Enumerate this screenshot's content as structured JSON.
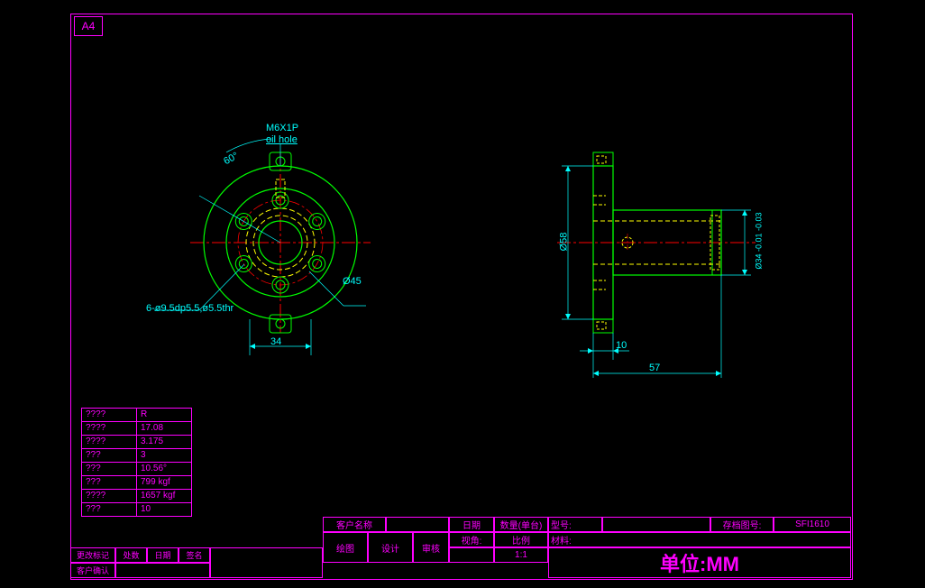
{
  "paper": "A4",
  "annotations": {
    "thread": "M6X1P",
    "oil_hole": "oil hole",
    "angle": "60°",
    "diameter45": "Ø45",
    "hole_spec": "6-ø9.5dp5.5,ø5.5thr",
    "dim34": "34",
    "dim58": "Ø58",
    "dim34_tol": "Ø34 -0.01 -0.03",
    "dim10": "10",
    "dim57": "57"
  },
  "spec_table": [
    {
      "k": "????",
      "v": "R"
    },
    {
      "k": "????",
      "v": "17.08"
    },
    {
      "k": "????",
      "v": "3.175"
    },
    {
      "k": "???",
      "v": "3"
    },
    {
      "k": "???",
      "v": "10.56°"
    },
    {
      "k": "???",
      "v": "799 kgf"
    },
    {
      "k": "????",
      "v": "1657 kgf"
    },
    {
      "k": "???",
      "v": "10"
    }
  ],
  "title_block": {
    "customer_label": "客户名称",
    "customer": "",
    "date_label": "日期",
    "date": "",
    "qty_label": "数量(单台)",
    "qty": "",
    "model_label": "型号:",
    "model": "",
    "drawing_no_label": "存档图号:",
    "drawing_no": "SFI1610",
    "material_label": "材料:",
    "drawn_label": "绘图",
    "design_label": "设计",
    "check_label": "审核",
    "view_label": "视角:",
    "scale_label": "比例",
    "scale": "1:1",
    "units_label": "单位:MM",
    "change_mark": "更改标记",
    "location": "处数",
    "date2": "日期",
    "sign": "签名",
    "cust_confirm": "客户确认"
  }
}
